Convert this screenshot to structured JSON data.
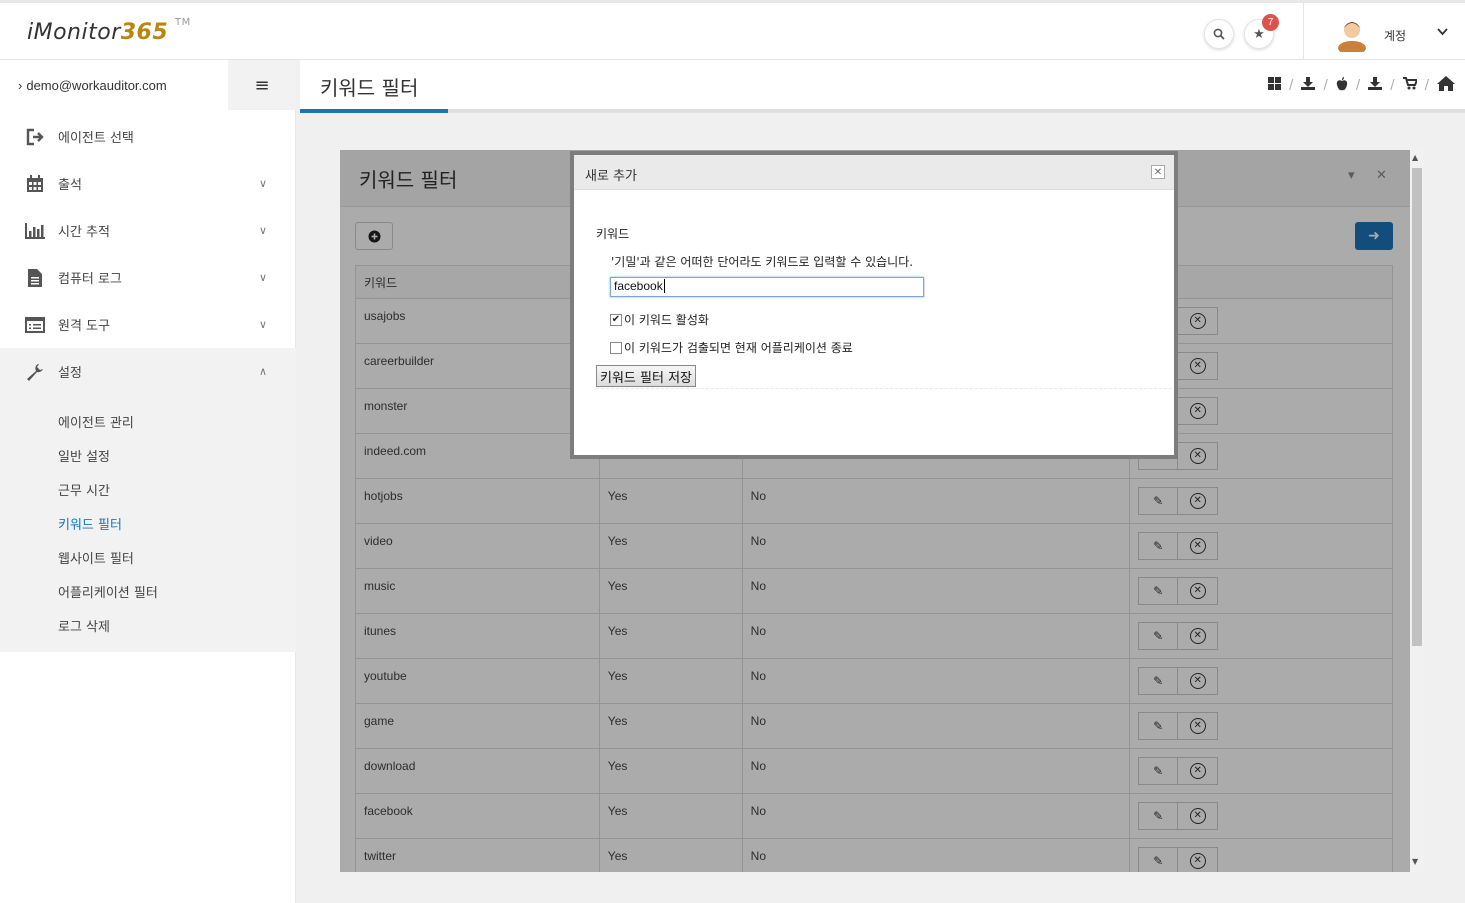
{
  "header": {
    "logo_text": "iMonitor",
    "logo_num": "365",
    "logo_tm": "TM",
    "search_icon": "search-icon",
    "star_icon": "star-icon",
    "notif_count": "7",
    "account_label": "계정"
  },
  "sidebar": {
    "user_email": "demo@workauditor.com",
    "items": [
      {
        "label": "에이전트 선택",
        "icon": "sign-out-icon"
      },
      {
        "label": "출석",
        "icon": "calendar-icon"
      },
      {
        "label": "시간 추적",
        "icon": "bar-chart-icon"
      },
      {
        "label": "컴퓨터 로그",
        "icon": "file-icon"
      },
      {
        "label": "원격 도구",
        "icon": "list-icon"
      },
      {
        "label": "설정",
        "icon": "wrench-icon"
      }
    ],
    "submenu": [
      {
        "label": "에이전트 관리"
      },
      {
        "label": "일반 설정"
      },
      {
        "label": "근무 시간"
      },
      {
        "label": "키워드 필터"
      },
      {
        "label": "웹사이트 필터"
      },
      {
        "label": "어플리케이션 필터"
      },
      {
        "label": "로그 삭제"
      }
    ]
  },
  "page": {
    "title": "키워드 필터",
    "breadcrumb_icons": [
      "windows-icon",
      "download-icon",
      "apple-icon",
      "download-icon",
      "cart-icon",
      "home-icon"
    ]
  },
  "panel": {
    "title": "키워드 필터",
    "table": {
      "headers": [
        "키워드",
        "",
        "",
        ""
      ],
      "rows": [
        {
          "keyword": "usajobs",
          "enabled": "",
          "close_app": ""
        },
        {
          "keyword": "careerbuilder",
          "enabled": "",
          "close_app": ""
        },
        {
          "keyword": "monster",
          "enabled": "",
          "close_app": ""
        },
        {
          "keyword": "indeed.com",
          "enabled": "",
          "close_app": ""
        },
        {
          "keyword": "hotjobs",
          "enabled": "Yes",
          "close_app": "No"
        },
        {
          "keyword": "video",
          "enabled": "Yes",
          "close_app": "No"
        },
        {
          "keyword": "music",
          "enabled": "Yes",
          "close_app": "No"
        },
        {
          "keyword": "itunes",
          "enabled": "Yes",
          "close_app": "No"
        },
        {
          "keyword": "youtube",
          "enabled": "Yes",
          "close_app": "No"
        },
        {
          "keyword": "game",
          "enabled": "Yes",
          "close_app": "No"
        },
        {
          "keyword": "download",
          "enabled": "Yes",
          "close_app": "No"
        },
        {
          "keyword": "facebook",
          "enabled": "Yes",
          "close_app": "No"
        },
        {
          "keyword": "twitter",
          "enabled": "Yes",
          "close_app": "No"
        }
      ]
    }
  },
  "modal": {
    "title": "새로 추가",
    "keyword_label": "키워드",
    "hint": "'기밀'과 같은 어떠한 단어라도 키워드로 입력할 수 있습니다.",
    "keyword_value": "facebook",
    "enable_label": "이 키워드 활성화",
    "enable_checked": true,
    "close_app_label": "이 키워드가 검출되면 현재 어플리케이션 종료",
    "close_app_checked": false,
    "save_label": "키워드 필터 저장"
  },
  "colors": {
    "accent": "#1a75b8",
    "badge": "#d9534f",
    "logo_num": "#b8860b"
  }
}
